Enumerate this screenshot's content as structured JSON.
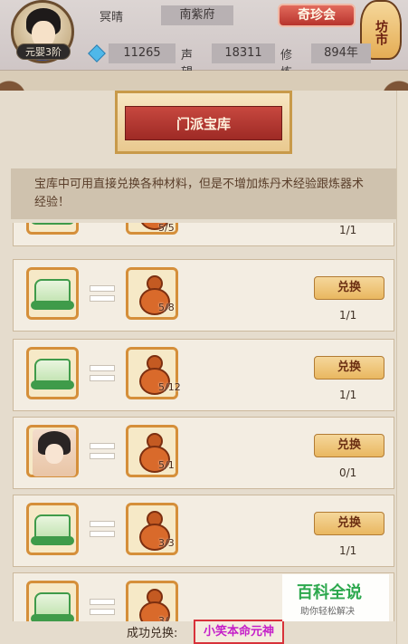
{
  "hud": {
    "level": "元婴3阶",
    "name": "冥晴",
    "sect": "南紫府",
    "treasure_button": "奇珍会",
    "market_label": "坊市",
    "spirit_stones": "11265",
    "reputation_label": "声望",
    "reputation": "18311",
    "cultivation_label": "修炼",
    "cultivation": "894年"
  },
  "title": "门派宝库",
  "notice": "宝库中可用直接兑换各种材料，但是不增加炼丹术经验跟炼器术经验！",
  "rows": [
    {
      "left_icon": "scroll-icon",
      "right_icon": "gourd-icon",
      "count": "5/5",
      "limit": "1/1",
      "button": ""
    },
    {
      "left_icon": "scroll-icon",
      "right_icon": "gourd-icon",
      "count": "5/8",
      "limit": "1/1",
      "button": "兑换"
    },
    {
      "left_icon": "scroll-icon",
      "right_icon": "gourd-icon",
      "count": "5/12",
      "limit": "1/1",
      "button": "兑换"
    },
    {
      "left_icon": "portrait-icon",
      "right_icon": "gourd-icon",
      "count": "5/1",
      "limit": "0/1",
      "button": "兑换"
    },
    {
      "left_icon": "scroll-icon",
      "right_icon": "gourd-icon",
      "count": "3/3",
      "limit": "1/1",
      "button": "兑换"
    },
    {
      "left_icon": "scroll-icon",
      "right_icon": "gourd-icon",
      "count": "3/",
      "limit": "",
      "button": ""
    }
  ],
  "footer": {
    "success_label": "成功兑换:",
    "success_item": "小笑本命元神"
  },
  "watermark": {
    "title": "百科全说",
    "subtitle": "助你轻松解决"
  }
}
